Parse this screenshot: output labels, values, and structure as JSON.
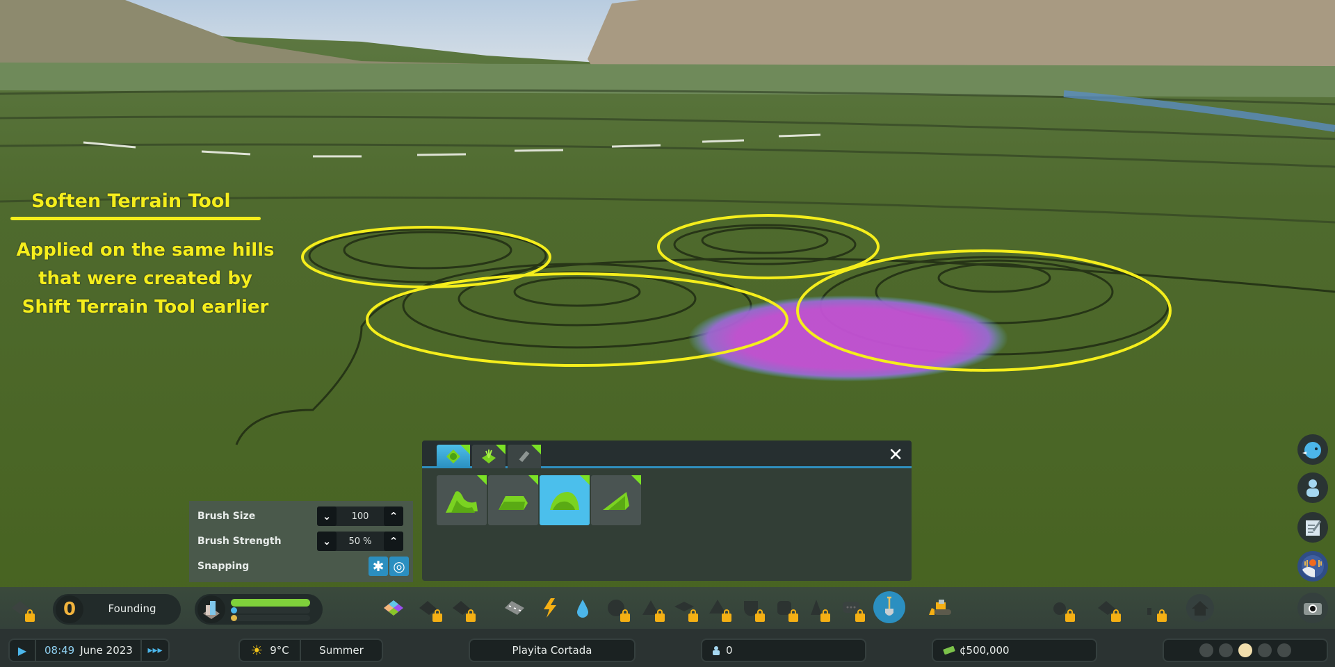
{
  "annotation": {
    "title": "Soften Terrain Tool",
    "body_lines": [
      "Applied on the same hills",
      "that were created by",
      "Shift Terrain Tool earlier"
    ],
    "color": "#f5ee1c"
  },
  "terrain_panel": {
    "tabs": [
      {
        "icon": "terrain-tab-icon",
        "active": true
      },
      {
        "icon": "vegetation-tab-icon",
        "active": false
      },
      {
        "icon": "surface-tab-icon",
        "active": false
      }
    ],
    "tools": [
      {
        "icon": "shift-terrain-icon",
        "active": false
      },
      {
        "icon": "level-terrain-icon",
        "active": false
      },
      {
        "icon": "soften-terrain-icon",
        "active": true
      },
      {
        "icon": "slope-terrain-icon",
        "active": false
      }
    ],
    "close_label": "✕"
  },
  "brush": {
    "size_label": "Brush Size",
    "size_value": "100",
    "strength_label": "Brush Strength",
    "strength_value": "50 %",
    "snapping_label": "Snapping",
    "down_glyph": "⌄",
    "up_glyph": "⌃",
    "snap_glyphs": [
      "✱",
      "◎"
    ]
  },
  "toolbar": {
    "milestone_value": "0",
    "milestone_label": "Founding",
    "progress": {
      "green": 1.0,
      "blue": 0.05,
      "yellow": 0.05
    },
    "accent": "#2b8fc0",
    "lock_color": "#f5b014"
  },
  "status": {
    "time": "08:49",
    "date": "June 2023",
    "temperature": "9°C",
    "season": "Summer",
    "city_name": "Playita Cortada",
    "population": "0",
    "money": "¢500,000",
    "happiness_selected_index": 2
  },
  "glyphs": {
    "play": "▶",
    "speed": "▸▸▸",
    "sun": "☀",
    "person": "👤",
    "money": "💵"
  }
}
